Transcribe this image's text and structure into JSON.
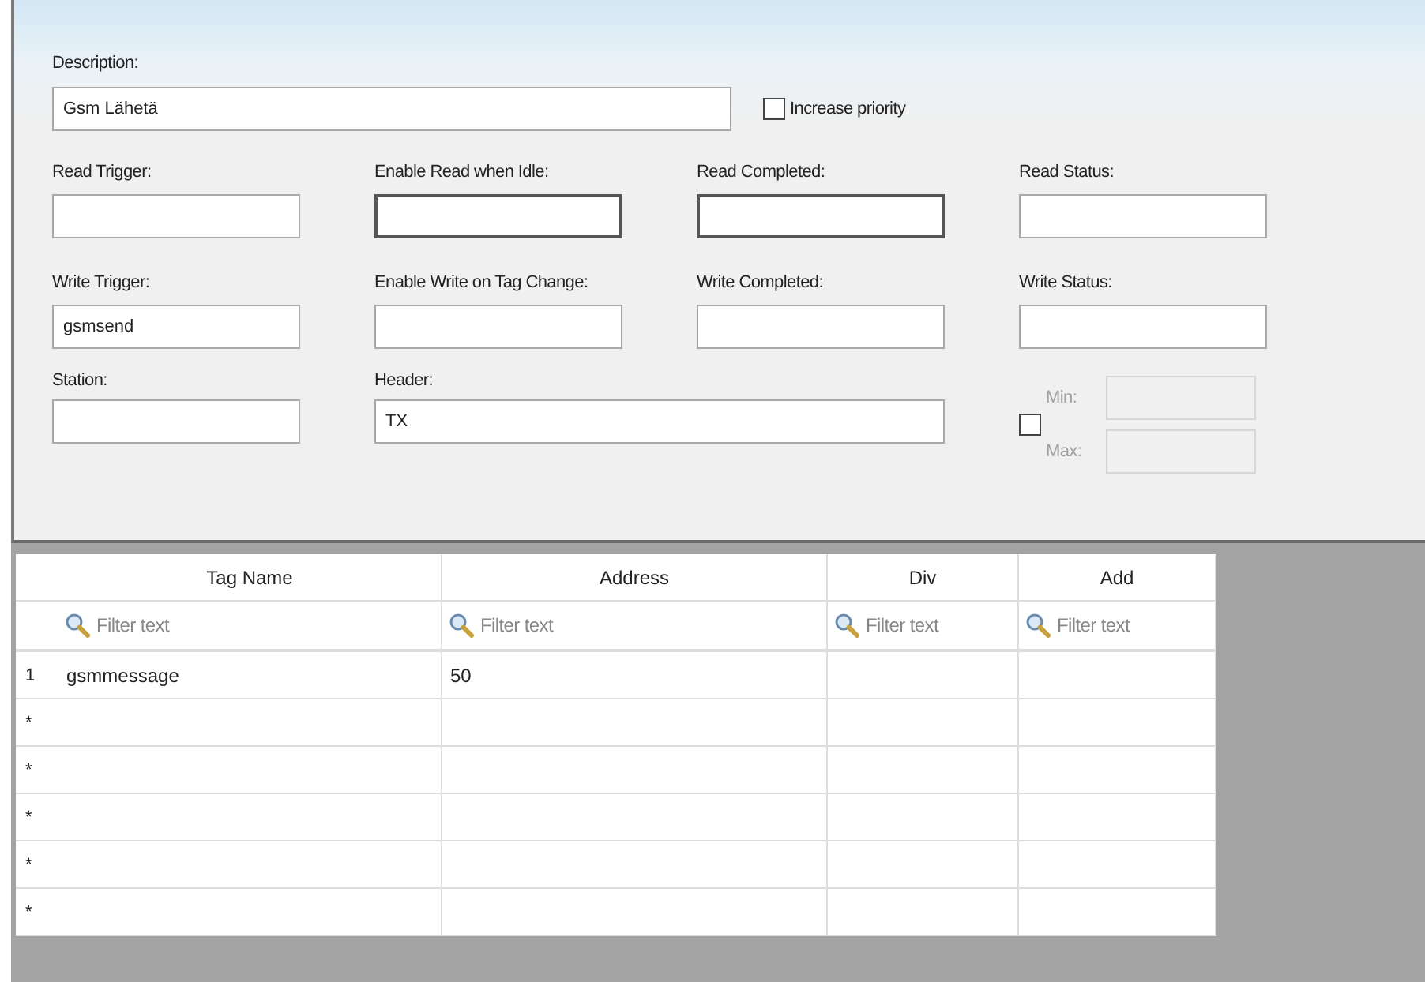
{
  "description": {
    "label": "Description:",
    "value": "Gsm Lähetä"
  },
  "increase_priority": {
    "label": "Increase priority",
    "checked": false
  },
  "field_rows": [
    [
      {
        "label": "Read Trigger:",
        "bold_border": false
      },
      {
        "label": "Enable Read when Idle:",
        "bold_border": true
      },
      {
        "label": "Read Completed:",
        "bold_border": true
      },
      {
        "label": "Read Status:",
        "bold_border": false
      }
    ],
    [
      {
        "label": "Write Trigger:",
        "value": "gsmsend",
        "bold_border": false
      },
      {
        "label": "Enable Write on Tag Change:",
        "bold_border": false
      },
      {
        "label": "Write Completed:",
        "bold_border": false
      },
      {
        "label": "Write Status:",
        "bold_border": false
      }
    ]
  ],
  "station": {
    "label": "Station:"
  },
  "header": {
    "label": "Header:",
    "value": "TX"
  },
  "range": {
    "checked": false,
    "disabled": true,
    "min_label": "Min:",
    "max_label": "Max:"
  },
  "table": {
    "columns": [
      {
        "title": "Tag Name",
        "filter_placeholder": "Filter text"
      },
      {
        "title": "Address",
        "filter_placeholder": "Filter text"
      },
      {
        "title": "Div",
        "filter_placeholder": "Filter text"
      },
      {
        "title": "Add",
        "filter_placeholder": "Filter text"
      }
    ],
    "rows": [
      {
        "marker": "1",
        "cells": [
          "gsmmessage",
          "50",
          null,
          null
        ]
      },
      {
        "marker": "*"
      },
      {
        "marker": "*"
      },
      {
        "marker": "*"
      },
      {
        "marker": "*"
      },
      {
        "marker": "*"
      }
    ]
  }
}
